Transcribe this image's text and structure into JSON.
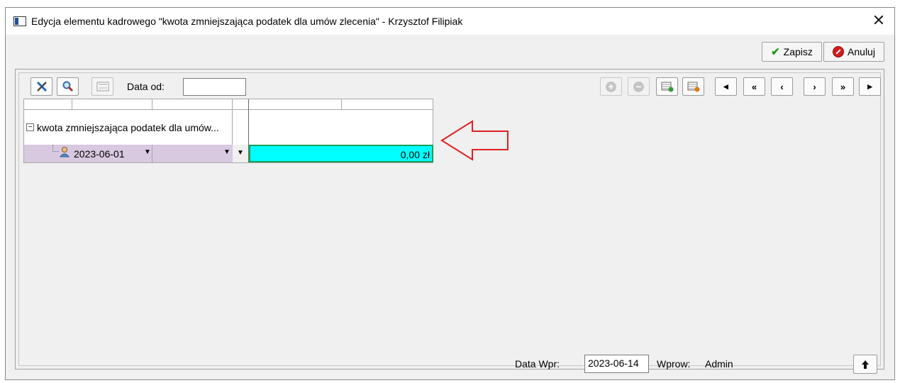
{
  "window": {
    "title": "Edycja elementu kadrowego \"kwota zmniejszająca podatek dla umów zlecenia\" - Krzysztof Filipiak",
    "close_glyph": "✕"
  },
  "header_buttons": {
    "save_label": "Zapisz",
    "cancel_label": "Anuluj"
  },
  "toolbar": {
    "date_from_label": "Data od:",
    "date_from_value": "",
    "nav": {
      "first": "◂",
      "prev_fast": "«",
      "prev": "‹",
      "next": "›",
      "next_fast": "»",
      "last": "▸"
    }
  },
  "grid": {
    "group_label": "kwota zmniejszająca podatek dla umów...",
    "row": {
      "date": "2023-06-01",
      "amount": "0,00 zł"
    }
  },
  "footer": {
    "date_label": "Data Wpr:",
    "date_value": "2023-06-14",
    "by_label": "Wprow:",
    "by_value": "Admin"
  },
  "colors": {
    "highlight_cell": "#00ffff",
    "row_background": "#d8c8e0",
    "arrow": "#e02020"
  },
  "icons": [
    "window-icon",
    "checkmark-icon",
    "cancel-icon",
    "tools-icon",
    "search-icon",
    "calculator-icon",
    "add-icon",
    "remove-icon",
    "table-add-icon",
    "table-edit-icon",
    "tree-collapse-icon",
    "person-icon",
    "dropdown-arrow-icon",
    "arrow-up-icon"
  ]
}
